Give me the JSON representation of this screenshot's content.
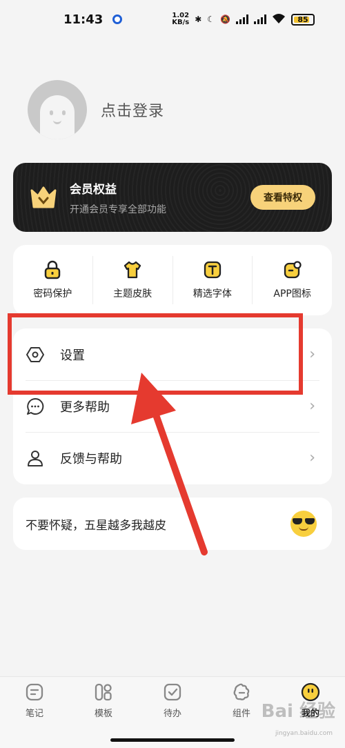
{
  "status_bar": {
    "time": "11:43",
    "net_speed_value": "1.02",
    "net_speed_unit": "KB/s",
    "battery": "85",
    "battery_color": "#f2c230"
  },
  "profile": {
    "login_text": "点击登录"
  },
  "vip": {
    "title": "会员权益",
    "subtitle": "开通会员专享全部功能",
    "button_label": "查看特权",
    "accent_color": "#f7d27a"
  },
  "features": [
    {
      "label": "密码保护",
      "icon": "lock-icon"
    },
    {
      "label": "主题皮肤",
      "icon": "shirt-icon"
    },
    {
      "label": "精选字体",
      "icon": "font-icon"
    },
    {
      "label": "APP图标",
      "icon": "app-icon"
    }
  ],
  "menu": [
    {
      "label": "设置",
      "icon": "settings-icon"
    },
    {
      "label": "更多帮助",
      "icon": "chat-icon"
    },
    {
      "label": "反馈与帮助",
      "icon": "user-icon"
    }
  ],
  "rating": {
    "text": "不要怀疑，五星越多我越皮"
  },
  "annotation": {
    "color": "#e53a2f"
  },
  "bottom_nav": [
    {
      "label": "笔记",
      "icon": "note-icon"
    },
    {
      "label": "模板",
      "icon": "template-icon"
    },
    {
      "label": "待办",
      "icon": "todo-icon"
    },
    {
      "label": "组件",
      "icon": "widget-icon"
    },
    {
      "label": "我的",
      "icon": "me-icon"
    }
  ],
  "bottom_nav_active": "我的",
  "watermark": {
    "text": "Bai 经验",
    "sub": "jingyan.baidu.com"
  }
}
